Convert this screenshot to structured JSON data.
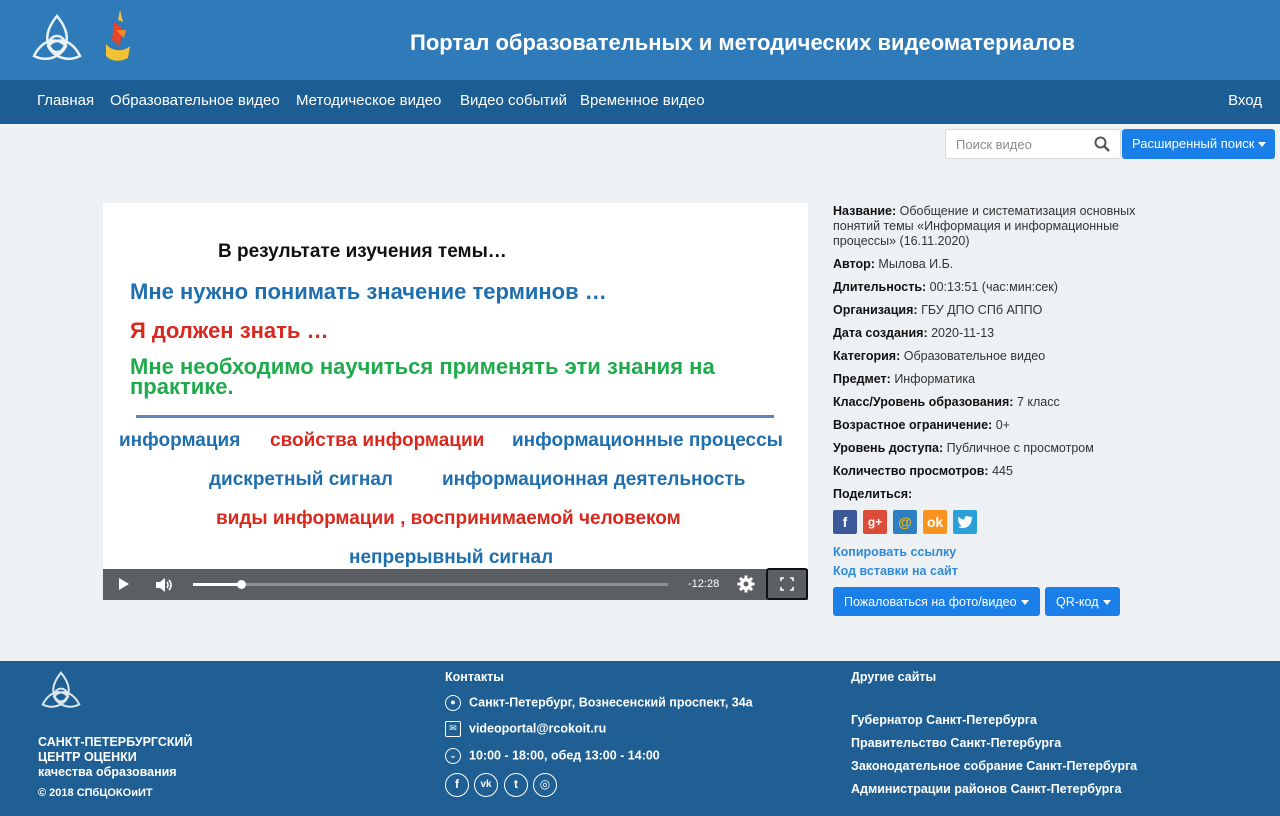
{
  "header": {
    "title": "Портал образовательных и методических видеоматериалов"
  },
  "nav": {
    "items": [
      "Главная",
      "Образовательное видео",
      "Методическое видео",
      "Видео событий",
      "Временное видео"
    ],
    "login": "Вход"
  },
  "search": {
    "placeholder": "Поиск видео",
    "advanced_label": "Расширенный поиск"
  },
  "video": {
    "slide": {
      "title": "В результате изучения темы…",
      "line1": "Мне нужно понимать  значение терминов …",
      "line2": "Я должен знать …",
      "line3": "Мне необходимо научиться  применять эти знания на практике.",
      "terms": {
        "t1": "информация",
        "t2": "свойства информации",
        "t3": "информационные процессы",
        "t4": "дискретный сигнал",
        "t5": "информационная деятельность",
        "t6": "виды информации , воспринимаемой человеком",
        "t7": "непрерывный сигнал"
      }
    },
    "controls": {
      "time_remaining": "-12:28",
      "progress": 0.1
    }
  },
  "info": {
    "name_label": "Название:",
    "name_value": "Обобщение и систематизация основных понятий темы «Информация и информационные процессы» (16.11.2020)",
    "author_label": "Автор:",
    "author_value": "Мылова И.Б.",
    "duration_label": "Длительность:",
    "duration_value": "00:13:51 (час:мин:сек)",
    "org_label": "Организация:",
    "org_value": "ГБУ ДПО СПб АППО",
    "date_label": "Дата создания:",
    "date_value": "2020-11-13",
    "category_label": "Категория:",
    "category_value": "Образовательное видео",
    "subject_label": "Предмет:",
    "subject_value": "Информатика",
    "class_label": "Класс/Уровень образования:",
    "class_value": "7 класс",
    "age_label": "Возрастное ограничение:",
    "age_value": "0+",
    "access_label": "Уровень доступа:",
    "access_value": "Публичное с просмотром",
    "views_label": "Количество просмотров:",
    "views_value": "445",
    "share_label": "Поделиться:",
    "copy_link": "Копировать ссылку",
    "embed_code": "Код вставки на сайт",
    "complain_button": "Пожаловаться на фото/видео",
    "qr_button": "QR-код"
  },
  "footer": {
    "org_line1": "САНКТ-ПЕТЕРБУРГСКИЙ",
    "org_line2": "ЦЕНТР ОЦЕНКИ",
    "org_line3": "качества образования",
    "copyright": "© 2018 СПбЦОКОиИТ",
    "contacts_title": "Контакты",
    "address": "Санкт-Петербург, Вознесенский проспект, 34а",
    "email": "videoportal@rcokoit.ru",
    "hours": "10:00 - 18:00, обед 13:00 - 14:00",
    "other_title": "Другие сайты",
    "links": [
      "Губернатор Санкт-Петербурга",
      "Правительство Санкт-Петербурга",
      "Законодательное собрание Санкт-Петербурга",
      "Администрации районов Санкт-Петербурга"
    ]
  },
  "colors": {
    "header_bg": "#2f7ab8",
    "nav_bg": "#1c5e93",
    "button_blue": "#1a7fe8",
    "link_blue": "#2e8ad8",
    "footer_bg": "#1f5f93"
  }
}
